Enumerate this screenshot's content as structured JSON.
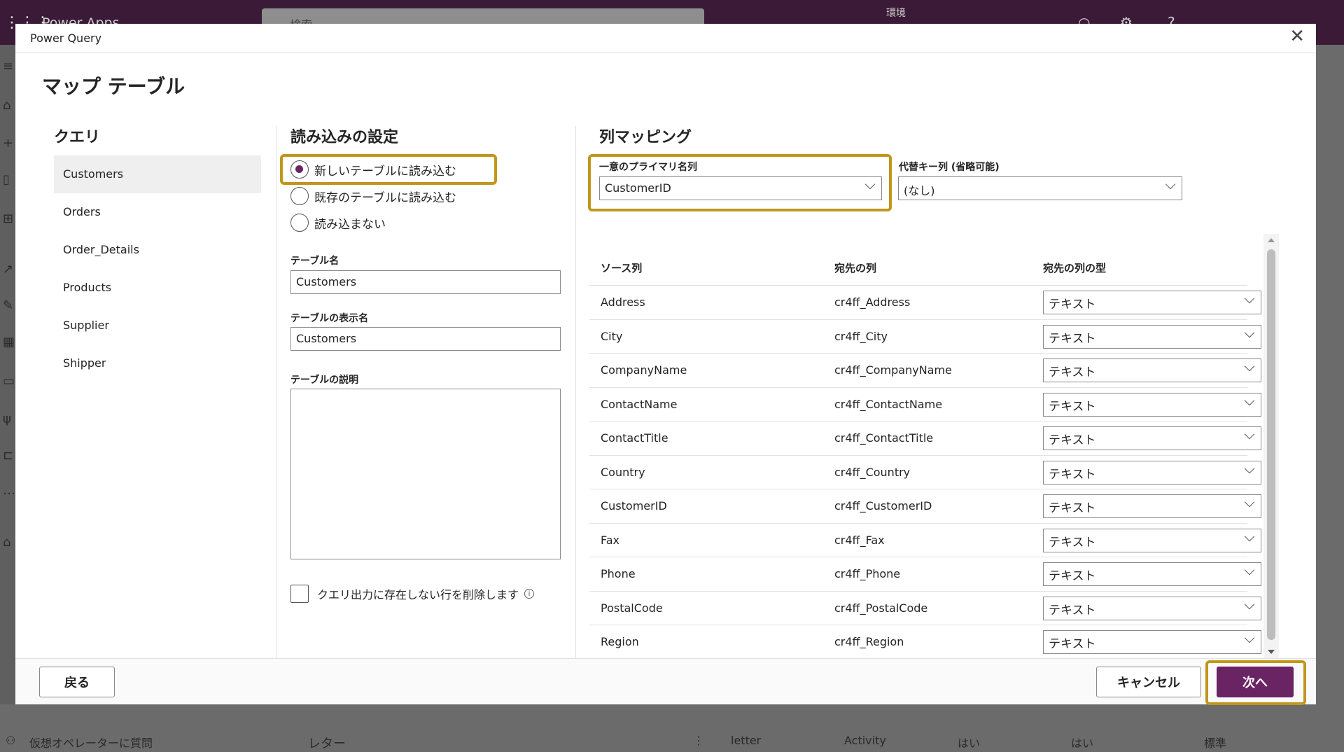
{
  "background_app": {
    "brand": "Power Apps",
    "search_placeholder": "検索",
    "environment_label": "環境",
    "bottom_row": {
      "ask_agent": "仮想オペレーターに質問",
      "name": "レター",
      "more": "⋮",
      "col1": "letter",
      "col2": "Activity",
      "col3": "はい",
      "col4": "はい",
      "col5": "標準"
    }
  },
  "dialog": {
    "header_title": "Power Query",
    "page_title": "マップ テーブル",
    "queries": {
      "title": "クエリ",
      "items": [
        "Customers",
        "Orders",
        "Order_Details",
        "Products",
        "Supplier",
        "Shipper"
      ],
      "selected": "Customers"
    },
    "load_settings": {
      "title": "読み込みの設定",
      "options": [
        "新しいテーブルに読み込む",
        "既存のテーブルに読み込む",
        "読み込まない"
      ],
      "selected_option": "新しいテーブルに読み込む",
      "table_name_label": "テーブル名",
      "table_name_value": "Customers",
      "display_name_label": "テーブルの表示名",
      "display_name_value": "Customers",
      "description_label": "テーブルの説明",
      "description_value": "",
      "delete_rows_label": "クエリ出力に存在しない行を削除します",
      "delete_rows_checked": false
    },
    "column_mapping": {
      "title": "列マッピング",
      "primary_key_label": "一意のプライマリ名列",
      "primary_key_value": "CustomerID",
      "alternate_key_label": "代替キー列 (省略可能)",
      "alternate_key_value": "(なし)",
      "headers": {
        "source": "ソース列",
        "destination": "宛先の列",
        "type": "宛先の列の型"
      },
      "rows": [
        {
          "source": "Address",
          "destination": "cr4ff_Address",
          "type": "テキスト"
        },
        {
          "source": "City",
          "destination": "cr4ff_City",
          "type": "テキスト"
        },
        {
          "source": "CompanyName",
          "destination": "cr4ff_CompanyName",
          "type": "テキスト"
        },
        {
          "source": "ContactName",
          "destination": "cr4ff_ContactName",
          "type": "テキスト"
        },
        {
          "source": "ContactTitle",
          "destination": "cr4ff_ContactTitle",
          "type": "テキスト"
        },
        {
          "source": "Country",
          "destination": "cr4ff_Country",
          "type": "テキスト"
        },
        {
          "source": "CustomerID",
          "destination": "cr4ff_CustomerID",
          "type": "テキスト"
        },
        {
          "source": "Fax",
          "destination": "cr4ff_Fax",
          "type": "テキスト"
        },
        {
          "source": "Phone",
          "destination": "cr4ff_Phone",
          "type": "テキスト"
        },
        {
          "source": "PostalCode",
          "destination": "cr4ff_PostalCode",
          "type": "テキスト"
        },
        {
          "source": "Region",
          "destination": "cr4ff_Region",
          "type": "テキスト"
        }
      ]
    },
    "footer": {
      "back_label": "戻る",
      "cancel_label": "キャンセル",
      "next_label": "次へ"
    }
  },
  "colors": {
    "accent": "#6b2463",
    "highlight": "#c0971c",
    "app_bar": "#3b1a38"
  }
}
